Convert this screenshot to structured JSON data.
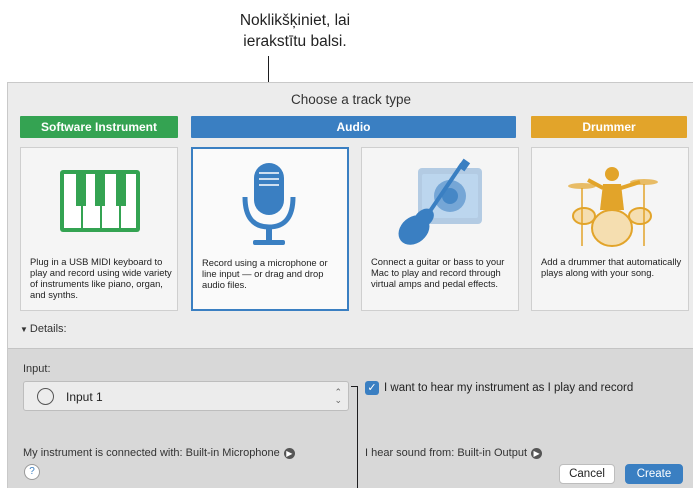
{
  "callout": {
    "line1": "Noklikšķiniet, lai",
    "line2": "ierakstītu balsi."
  },
  "dialog": {
    "title": "Choose a track type",
    "categories": {
      "software": "Software Instrument",
      "audio": "Audio",
      "drummer": "Drummer"
    },
    "tiles": [
      {
        "desc": "Plug in a USB MIDI keyboard to play and record using wide variety of instruments like piano, organ, and synths.",
        "icon": "piano-keys-icon"
      },
      {
        "desc": "Record using a microphone or line input — or drag and drop audio files.",
        "icon": "microphone-icon"
      },
      {
        "desc": "Connect a guitar or bass to your Mac to play and record through virtual amps and pedal effects.",
        "icon": "guitar-amp-icon"
      },
      {
        "desc": "Add a drummer that automatically plays along with your song.",
        "icon": "drummer-icon"
      }
    ],
    "details_label": "Details:",
    "input_label": "Input:",
    "input_value": "Input 1",
    "monitor_label": "I want to hear my instrument as I play and record",
    "connected_label": "My instrument is connected with: Built-in Microphone",
    "output_label": "I hear sound from: Built-in Output",
    "help_label": "?",
    "cancel_label": "Cancel",
    "create_label": "Create"
  },
  "colors": {
    "software": "#34a352",
    "audio": "#3a7fc2",
    "drummer": "#e2a42a"
  }
}
